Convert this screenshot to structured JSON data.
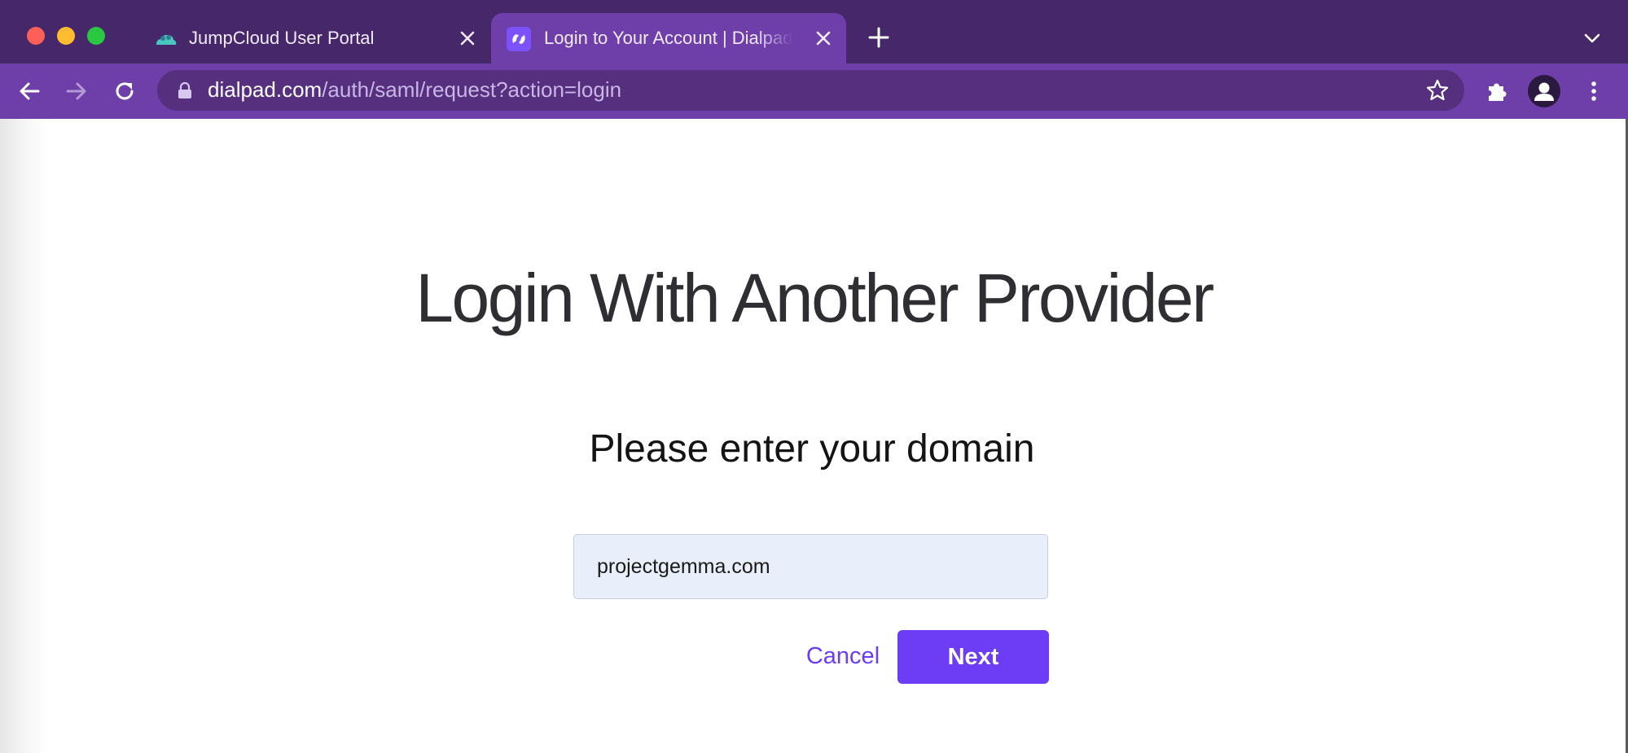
{
  "browser": {
    "tabs": [
      {
        "title": "JumpCloud User Portal",
        "active": false,
        "favicon": "jumpcloud-cloud-icon"
      },
      {
        "title": "Login to Your Account | Dialpad",
        "active": true,
        "favicon": "dialpad-icon"
      }
    ],
    "url": {
      "host": "dialpad.com",
      "path": "/auth/saml/request?action=login"
    }
  },
  "page": {
    "heading": "Login With Another Provider",
    "subheading": "Please enter your domain",
    "domain_input": {
      "value": "projectgemma.com",
      "placeholder": ""
    },
    "cancel_label": "Cancel",
    "next_label": "Next"
  },
  "colors": {
    "titlebar": "#46276a",
    "toolbar": "#6e3fa8",
    "accent": "#6c3df5",
    "input_bg": "#e8effb"
  }
}
